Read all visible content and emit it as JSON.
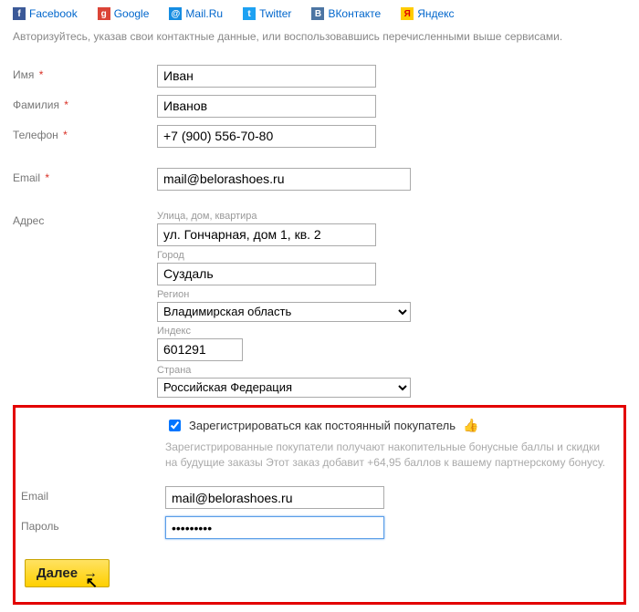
{
  "social": [
    {
      "label": "Facebook",
      "icon_bg": "#3b5998",
      "icon_char": "f"
    },
    {
      "label": "Google",
      "icon_bg": "#db4437",
      "icon_char": "g"
    },
    {
      "label": "Mail.Ru",
      "icon_bg": "#168de2",
      "icon_char": "@"
    },
    {
      "label": "Twitter",
      "icon_bg": "#1da1f2",
      "icon_char": "t"
    },
    {
      "label": "ВКонтакте",
      "icon_bg": "#4c75a3",
      "icon_char": "B"
    },
    {
      "label": "Яндекс",
      "icon_bg": "#ffcc00",
      "icon_char": "Я"
    }
  ],
  "intro": "Авторизуйтесь, указав свои контактные данные, или воспользовавшись перечисленными выше сервисами.",
  "labels": {
    "name": "Имя",
    "surname": "Фамилия",
    "phone": "Телефон",
    "email": "Email",
    "address": "Адрес",
    "street": "Улица, дом, квартира",
    "city": "Город",
    "region": "Регион",
    "index": "Индекс",
    "country": "Страна",
    "email2": "Email",
    "password": "Пароль"
  },
  "values": {
    "name": "Иван",
    "surname": "Иванов",
    "phone": "+7 (900) 556-70-80",
    "email": "mail@belorashoes.ru",
    "street": "ул. Гончарная, дом 1, кв. 2",
    "city": "Суздаль",
    "region": "Владимирская область",
    "index": "601291",
    "country": "Российская Федерация",
    "email2": "mail@belorashoes.ru",
    "password": "•••••••••"
  },
  "register": {
    "checkbox_label": "Зарегистрироваться как постоянный покупатель",
    "desc": "Зарегистрированные покупатели получают накопительные бонусные баллы и скидки на будущие заказы Этот заказ добавит +64,95 баллов к вашему партнерскому бонусу."
  },
  "button_next": "Далее"
}
